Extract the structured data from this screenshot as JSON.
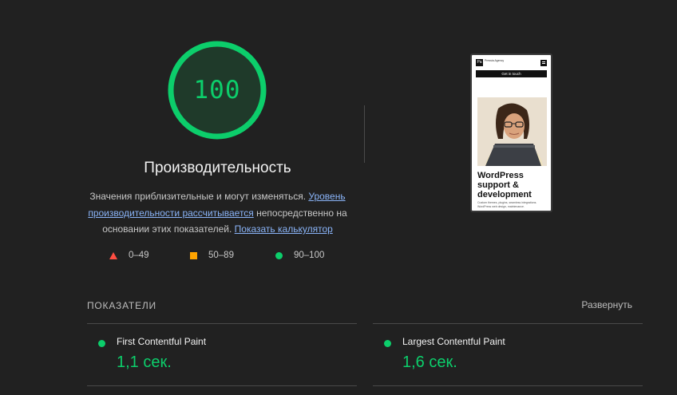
{
  "gauge": {
    "score": "100",
    "score_fraction": 1.0,
    "color": "#0cce6b"
  },
  "title": "Производительность",
  "description": {
    "text1": "Значения приблизительные и могут изменяться. ",
    "link1": "Уровень производительности рассчитывается",
    "text2": " непосредственно на основании этих показателей. ",
    "link2": "Показать калькулятор"
  },
  "legend": [
    {
      "label": "0–49",
      "icon": "red-triangle-icon",
      "color": "#ff4e42"
    },
    {
      "label": "50–89",
      "icon": "orange-square-icon",
      "color": "#ffa400"
    },
    {
      "label": "90–100",
      "icon": "green-circle-icon",
      "color": "#0cce6b"
    }
  ],
  "preview": {
    "logo": "Pa",
    "brand": "Pressia Agency",
    "cta": "Get in touch",
    "heading": "WordPress support & development",
    "body": "Custom themes, plugins, seamless integrations. WordPress web design, maintenance."
  },
  "metrics": {
    "section_label": "ПОКАЗАТЕЛИ",
    "expand_label": "Развернуть",
    "items": [
      {
        "name": "First Contentful Paint",
        "value": "1,1 сек.",
        "status_color": "#0cce6b"
      },
      {
        "name": "Largest Contentful Paint",
        "value": "1,6 сек.",
        "status_color": "#0cce6b"
      }
    ]
  }
}
